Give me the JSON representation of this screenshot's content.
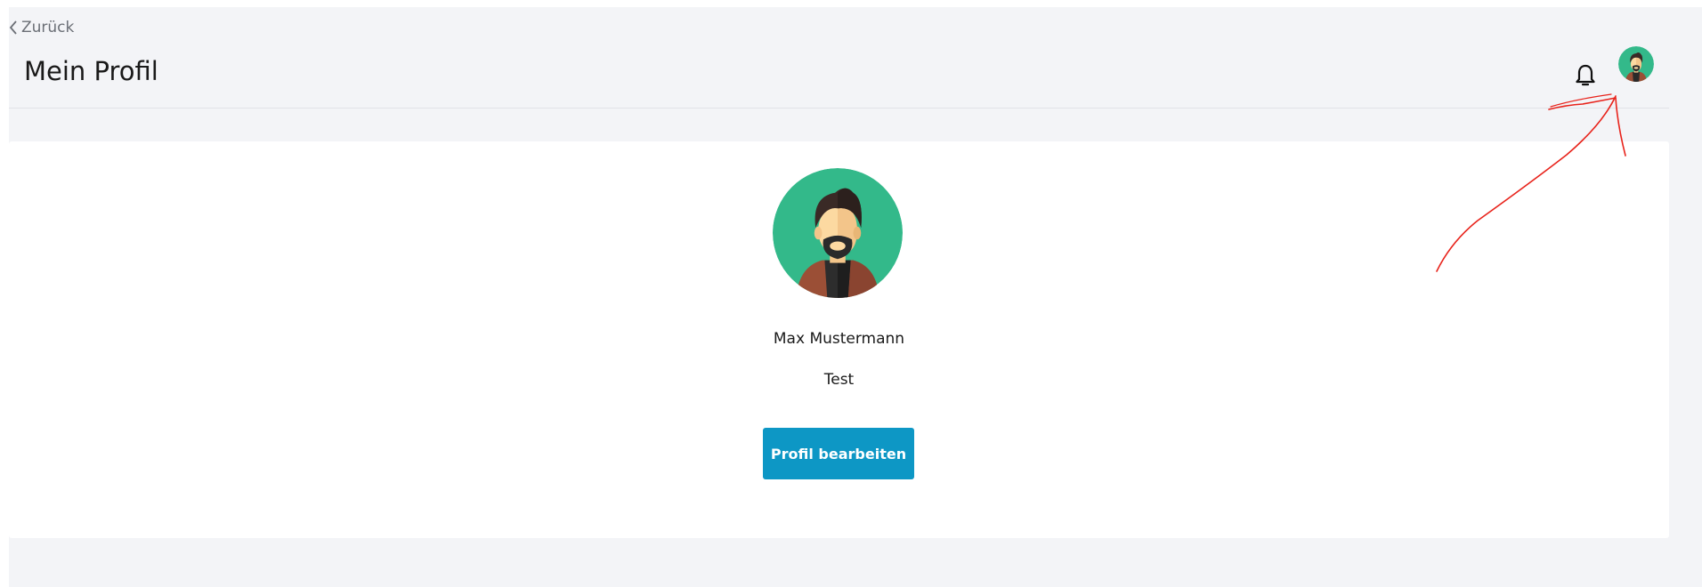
{
  "header": {
    "back_label": "Zurück",
    "title": "Mein Profil",
    "notification_icon": "bell-icon",
    "user_avatar_icon": "avatar"
  },
  "profile": {
    "name": "Max Mustermann",
    "subtitle": "Test",
    "edit_button_label": "Profil bearbeiten"
  },
  "colors": {
    "background": "#f3f4f7",
    "card": "#ffffff",
    "primary_button": "#0d97c5",
    "avatar_background": "#33b98a",
    "annotation": "#e8231b"
  }
}
